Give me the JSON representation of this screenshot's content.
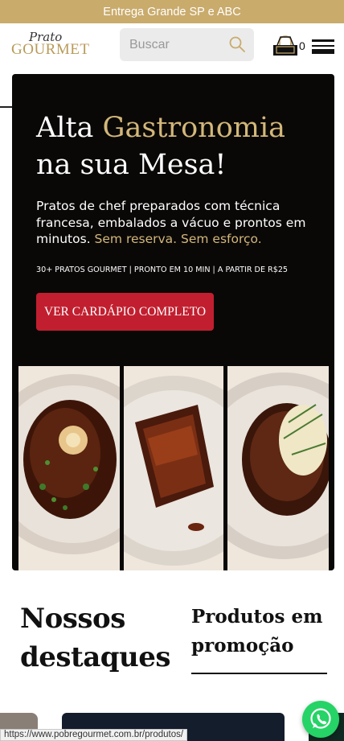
{
  "topbar": {
    "text": "Entrega Grande SP e ABC"
  },
  "header": {
    "logo": {
      "script": "Prato",
      "word": "GOURMET"
    },
    "search": {
      "placeholder": "Buscar"
    },
    "cart": {
      "count": "0"
    }
  },
  "hero": {
    "title_line1_a": "Alta ",
    "title_line1_b": "Gastronomia",
    "title_line2": "na sua Mesa!",
    "subtitle_a": "Pratos de chef preparados com técnica francesa, embalados a vácuo e prontos em minutos. ",
    "subtitle_b": "Sem reserva. Sem esforço.",
    "stats": "30+ PRATOS GOURMET | PRONTO EM 10 MIN | A PARTIR DE R$25",
    "cta_label": "VER CARDÁPIO COMPLETO"
  },
  "sections": {
    "highlights_title": "Nossos destaques",
    "promo_title": "Produtos em promoção"
  },
  "status_url": "https://www.pobregourmet.com.br/produtos/",
  "colors": {
    "gold": "#c9ab6c",
    "cta_red": "#c11f2f",
    "hero_bg": "#0a0807",
    "whatsapp": "#25d366"
  },
  "icons": [
    "search-icon",
    "cart-icon",
    "menu-icon",
    "whatsapp-icon"
  ]
}
